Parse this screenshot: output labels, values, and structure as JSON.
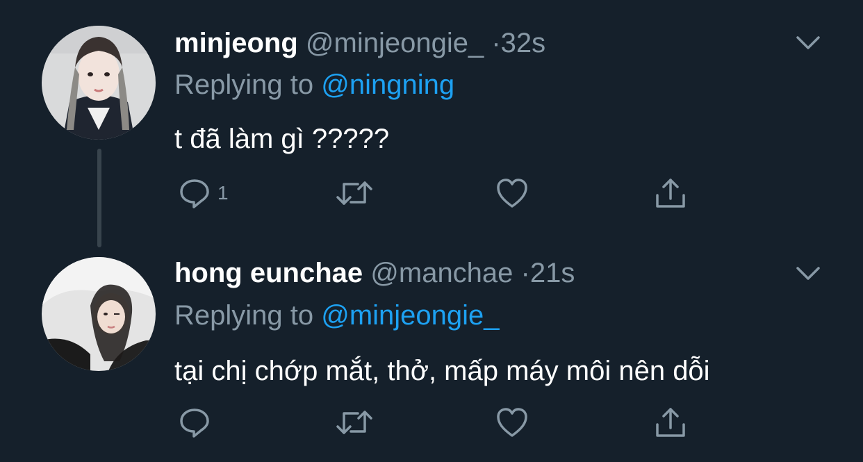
{
  "colors": {
    "background": "#15202b",
    "text": "#ffffff",
    "muted": "#8899a6",
    "link": "#1da1f2",
    "thread_line": "#38444d"
  },
  "tweets": [
    {
      "name": "minjeong",
      "handle": "@minjeongie_",
      "dot": "·",
      "time": "32s",
      "replying_prefix": "Replying to ",
      "replying_handle": "@ningning",
      "text": "t đã làm gì ?????",
      "reply_count": "1",
      "icons": [
        "reply-icon",
        "retweet-icon",
        "like-icon",
        "share-icon",
        "chevron-down-icon"
      ]
    },
    {
      "name": "hong eunchae",
      "handle": "@manchae",
      "dot": "·",
      "time": "21s",
      "replying_prefix": "Replying to ",
      "replying_handle": "@minjeongie_",
      "text": "tại chị chớp mắt, thở, mấp máy môi nên dỗi",
      "reply_count": "",
      "icons": [
        "reply-icon",
        "retweet-icon",
        "like-icon",
        "share-icon",
        "chevron-down-icon"
      ]
    }
  ]
}
